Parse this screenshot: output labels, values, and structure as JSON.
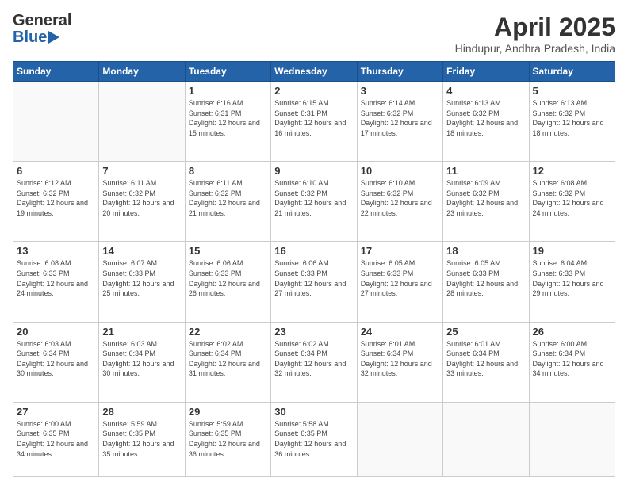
{
  "header": {
    "logo_line1": "General",
    "logo_line2": "Blue",
    "title": "April 2025",
    "location": "Hindupur, Andhra Pradesh, India"
  },
  "days_of_week": [
    "Sunday",
    "Monday",
    "Tuesday",
    "Wednesday",
    "Thursday",
    "Friday",
    "Saturday"
  ],
  "weeks": [
    [
      {
        "day": "",
        "info": ""
      },
      {
        "day": "",
        "info": ""
      },
      {
        "day": "1",
        "info": "Sunrise: 6:16 AM\nSunset: 6:31 PM\nDaylight: 12 hours and 15 minutes."
      },
      {
        "day": "2",
        "info": "Sunrise: 6:15 AM\nSunset: 6:31 PM\nDaylight: 12 hours and 16 minutes."
      },
      {
        "day": "3",
        "info": "Sunrise: 6:14 AM\nSunset: 6:32 PM\nDaylight: 12 hours and 17 minutes."
      },
      {
        "day": "4",
        "info": "Sunrise: 6:13 AM\nSunset: 6:32 PM\nDaylight: 12 hours and 18 minutes."
      },
      {
        "day": "5",
        "info": "Sunrise: 6:13 AM\nSunset: 6:32 PM\nDaylight: 12 hours and 18 minutes."
      }
    ],
    [
      {
        "day": "6",
        "info": "Sunrise: 6:12 AM\nSunset: 6:32 PM\nDaylight: 12 hours and 19 minutes."
      },
      {
        "day": "7",
        "info": "Sunrise: 6:11 AM\nSunset: 6:32 PM\nDaylight: 12 hours and 20 minutes."
      },
      {
        "day": "8",
        "info": "Sunrise: 6:11 AM\nSunset: 6:32 PM\nDaylight: 12 hours and 21 minutes."
      },
      {
        "day": "9",
        "info": "Sunrise: 6:10 AM\nSunset: 6:32 PM\nDaylight: 12 hours and 21 minutes."
      },
      {
        "day": "10",
        "info": "Sunrise: 6:10 AM\nSunset: 6:32 PM\nDaylight: 12 hours and 22 minutes."
      },
      {
        "day": "11",
        "info": "Sunrise: 6:09 AM\nSunset: 6:32 PM\nDaylight: 12 hours and 23 minutes."
      },
      {
        "day": "12",
        "info": "Sunrise: 6:08 AM\nSunset: 6:32 PM\nDaylight: 12 hours and 24 minutes."
      }
    ],
    [
      {
        "day": "13",
        "info": "Sunrise: 6:08 AM\nSunset: 6:33 PM\nDaylight: 12 hours and 24 minutes."
      },
      {
        "day": "14",
        "info": "Sunrise: 6:07 AM\nSunset: 6:33 PM\nDaylight: 12 hours and 25 minutes."
      },
      {
        "day": "15",
        "info": "Sunrise: 6:06 AM\nSunset: 6:33 PM\nDaylight: 12 hours and 26 minutes."
      },
      {
        "day": "16",
        "info": "Sunrise: 6:06 AM\nSunset: 6:33 PM\nDaylight: 12 hours and 27 minutes."
      },
      {
        "day": "17",
        "info": "Sunrise: 6:05 AM\nSunset: 6:33 PM\nDaylight: 12 hours and 27 minutes."
      },
      {
        "day": "18",
        "info": "Sunrise: 6:05 AM\nSunset: 6:33 PM\nDaylight: 12 hours and 28 minutes."
      },
      {
        "day": "19",
        "info": "Sunrise: 6:04 AM\nSunset: 6:33 PM\nDaylight: 12 hours and 29 minutes."
      }
    ],
    [
      {
        "day": "20",
        "info": "Sunrise: 6:03 AM\nSunset: 6:34 PM\nDaylight: 12 hours and 30 minutes."
      },
      {
        "day": "21",
        "info": "Sunrise: 6:03 AM\nSunset: 6:34 PM\nDaylight: 12 hours and 30 minutes."
      },
      {
        "day": "22",
        "info": "Sunrise: 6:02 AM\nSunset: 6:34 PM\nDaylight: 12 hours and 31 minutes."
      },
      {
        "day": "23",
        "info": "Sunrise: 6:02 AM\nSunset: 6:34 PM\nDaylight: 12 hours and 32 minutes."
      },
      {
        "day": "24",
        "info": "Sunrise: 6:01 AM\nSunset: 6:34 PM\nDaylight: 12 hours and 32 minutes."
      },
      {
        "day": "25",
        "info": "Sunrise: 6:01 AM\nSunset: 6:34 PM\nDaylight: 12 hours and 33 minutes."
      },
      {
        "day": "26",
        "info": "Sunrise: 6:00 AM\nSunset: 6:34 PM\nDaylight: 12 hours and 34 minutes."
      }
    ],
    [
      {
        "day": "27",
        "info": "Sunrise: 6:00 AM\nSunset: 6:35 PM\nDaylight: 12 hours and 34 minutes."
      },
      {
        "day": "28",
        "info": "Sunrise: 5:59 AM\nSunset: 6:35 PM\nDaylight: 12 hours and 35 minutes."
      },
      {
        "day": "29",
        "info": "Sunrise: 5:59 AM\nSunset: 6:35 PM\nDaylight: 12 hours and 36 minutes."
      },
      {
        "day": "30",
        "info": "Sunrise: 5:58 AM\nSunset: 6:35 PM\nDaylight: 12 hours and 36 minutes."
      },
      {
        "day": "",
        "info": ""
      },
      {
        "day": "",
        "info": ""
      },
      {
        "day": "",
        "info": ""
      }
    ]
  ]
}
